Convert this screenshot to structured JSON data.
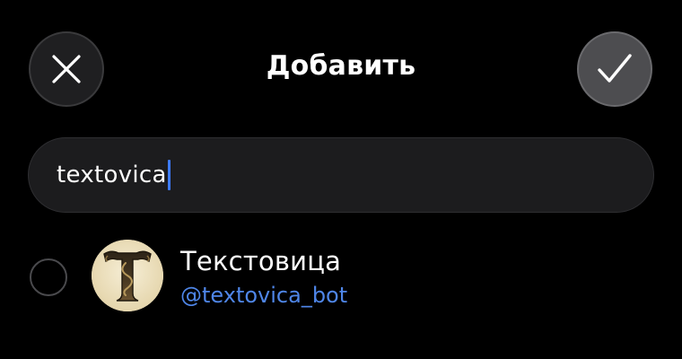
{
  "header": {
    "title": "Добавить",
    "close_icon": "close-icon",
    "confirm_icon": "checkmark-icon"
  },
  "search": {
    "value": "textovica"
  },
  "results": [
    {
      "name": "Текстовица",
      "username": "@textovica_bot",
      "avatar_letter": "T",
      "selected": false
    }
  ],
  "colors": {
    "background": "#000000",
    "accent": "#3d7bff",
    "username_link": "#4f86e8",
    "field_background": "#1c1c1e"
  }
}
